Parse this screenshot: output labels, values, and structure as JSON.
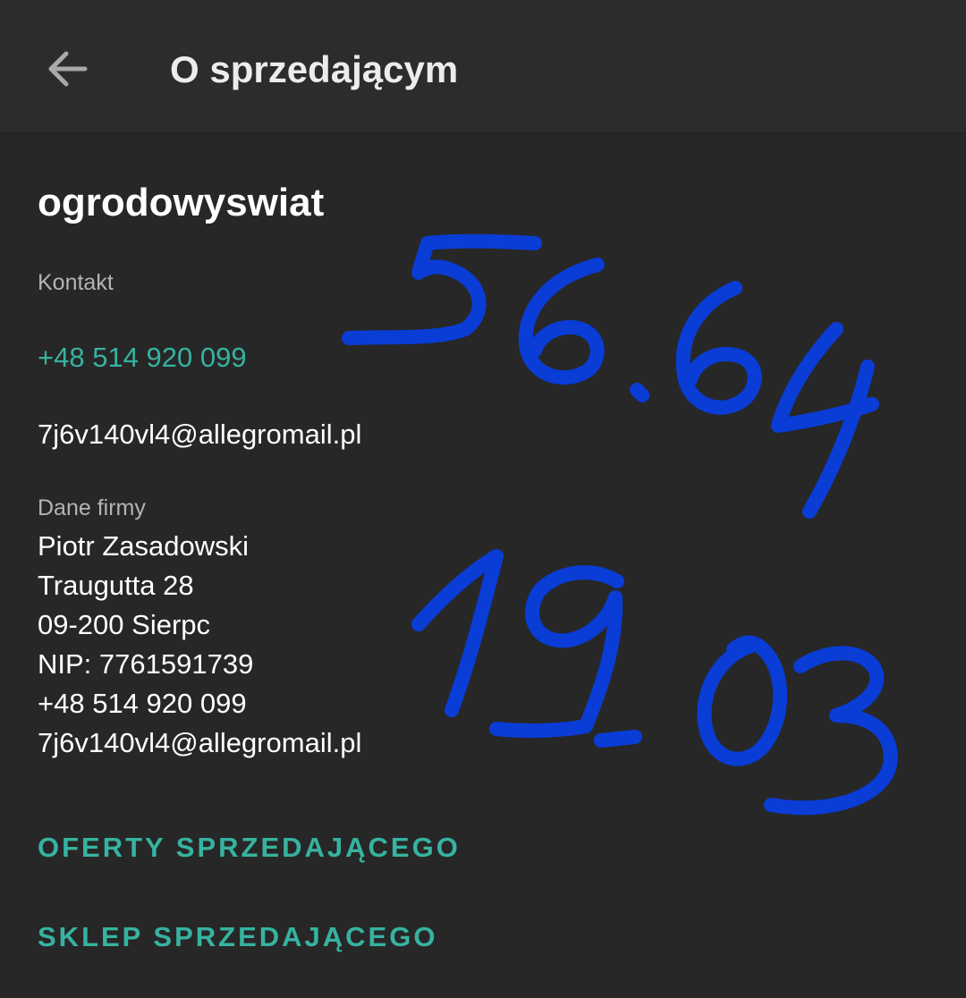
{
  "app_bar": {
    "title": "O sprzedającym",
    "back_icon": "arrow-back-icon"
  },
  "seller": {
    "name": "ogrodowyswiat"
  },
  "contact": {
    "label": "Kontakt",
    "phone": "+48 514 920 099",
    "email": "7j6v140vl4@allegromail.pl"
  },
  "company": {
    "label": "Dane firmy",
    "lines": [
      "Piotr Zasadowski",
      "Traugutta 28",
      "09-200 Sierpc",
      "NIP: 7761591739",
      "+48 514 920 099",
      "7j6v140vl4@allegromail.pl"
    ]
  },
  "actions": {
    "offers": "OFERTY SPRZEDAJĄCEGO",
    "shop": "SKLEP SPRZEDAJĄCEGO"
  },
  "handwritten_annotation": {
    "lines": [
      "56.64",
      "19.03"
    ],
    "color": "#0a3cd6"
  },
  "colors": {
    "background": "#272727",
    "app_bar": "#2c2c2c",
    "accent": "#36b3a0",
    "ink": "#0a3cd6"
  }
}
